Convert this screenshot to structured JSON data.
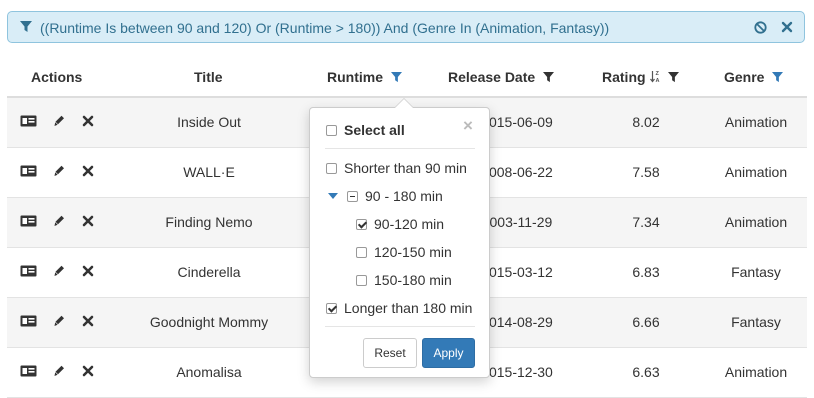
{
  "filter": {
    "expression": "((Runtime Is between 90 and 120) Or (Runtime > 180)) And (Genre In (Animation, Fantasy))"
  },
  "columns": {
    "actions": "Actions",
    "title": "Title",
    "runtime": "Runtime",
    "release_date": "Release Date",
    "rating": "Rating",
    "genre": "Genre"
  },
  "rows": [
    {
      "title": "Inside Out",
      "release_date": "2015-06-09",
      "rating": "8.02",
      "genre": "Animation"
    },
    {
      "title": "WALL·E",
      "release_date": "2008-06-22",
      "rating": "7.58",
      "genre": "Animation"
    },
    {
      "title": "Finding Nemo",
      "release_date": "2003-11-29",
      "rating": "7.34",
      "genre": "Animation"
    },
    {
      "title": "Cinderella",
      "release_date": "2015-03-12",
      "rating": "6.83",
      "genre": "Fantasy"
    },
    {
      "title": "Goodnight Mommy",
      "release_date": "2014-08-29",
      "rating": "6.66",
      "genre": "Fantasy"
    },
    {
      "title": "Anomalisa",
      "release_date": "2015-12-30",
      "rating": "6.63",
      "genre": "Animation"
    }
  ],
  "popup": {
    "select_all": "Select all",
    "options": [
      {
        "label": "Shorter than 90 min",
        "state": "unchecked"
      },
      {
        "label": "90 - 180 min",
        "state": "partial"
      },
      {
        "label": "90-120 min",
        "state": "checked"
      },
      {
        "label": "120-150 min",
        "state": "unchecked"
      },
      {
        "label": "150-180 min",
        "state": "unchecked"
      },
      {
        "label": "Longer than 180 min",
        "state": "checked"
      }
    ],
    "reset": "Reset",
    "apply": "Apply"
  },
  "colors": {
    "accent": "#337ab7",
    "filter_bg": "#d9edf7",
    "filter_text": "#31708f"
  }
}
